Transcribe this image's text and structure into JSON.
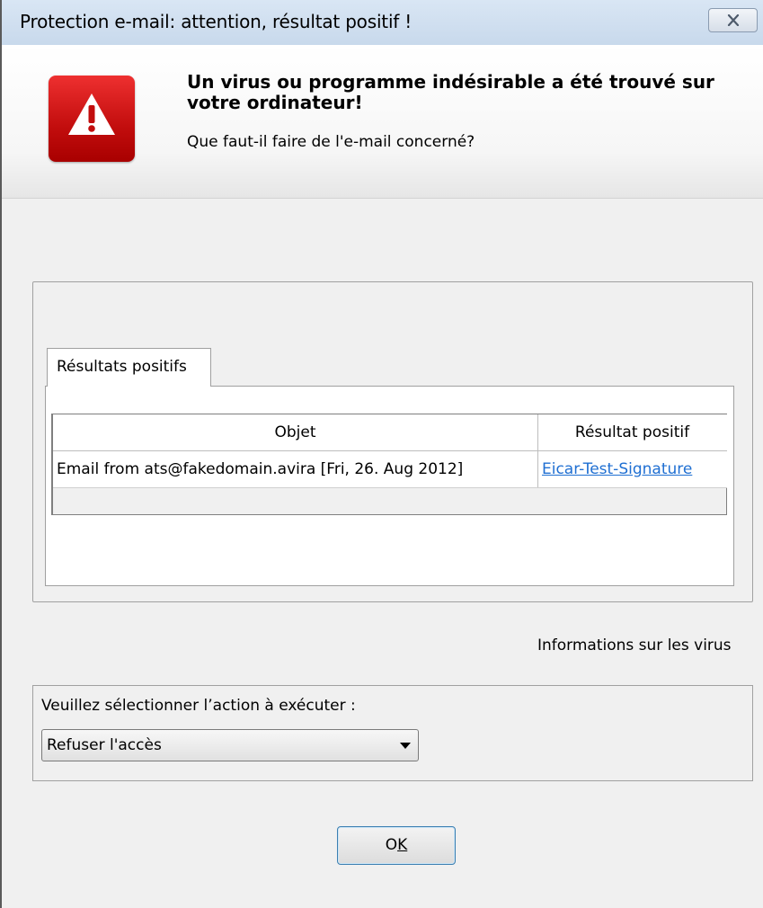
{
  "window": {
    "title": "Protection e-mail: attention, résultat positif !"
  },
  "header": {
    "headline": "Un virus ou programme indésirable a été trouvé sur votre ordinateur!",
    "question": "Que faut-il faire de l'e-mail concerné?",
    "icon": "warning-triangle-icon",
    "icon_color": "#d11a1a"
  },
  "results": {
    "tab_label": "Résultats positifs",
    "columns": [
      "Objet",
      "Résultat positif"
    ],
    "rows": [
      {
        "object": "Email from ats@fakedomain.avira [Fri, 26. Aug 2012]",
        "detection": "Eicar-Test-Signature"
      }
    ]
  },
  "virus_info_link": "Informations sur les virus",
  "action": {
    "label": "Veuillez sélectionner l’action à exécuter :",
    "selected": "Refuser l'accès"
  },
  "buttons": {
    "ok_prefix": "O",
    "ok_accel": "K"
  },
  "colors": {
    "link": "#1f6fd2",
    "titlebar": "#c8d9ec"
  }
}
